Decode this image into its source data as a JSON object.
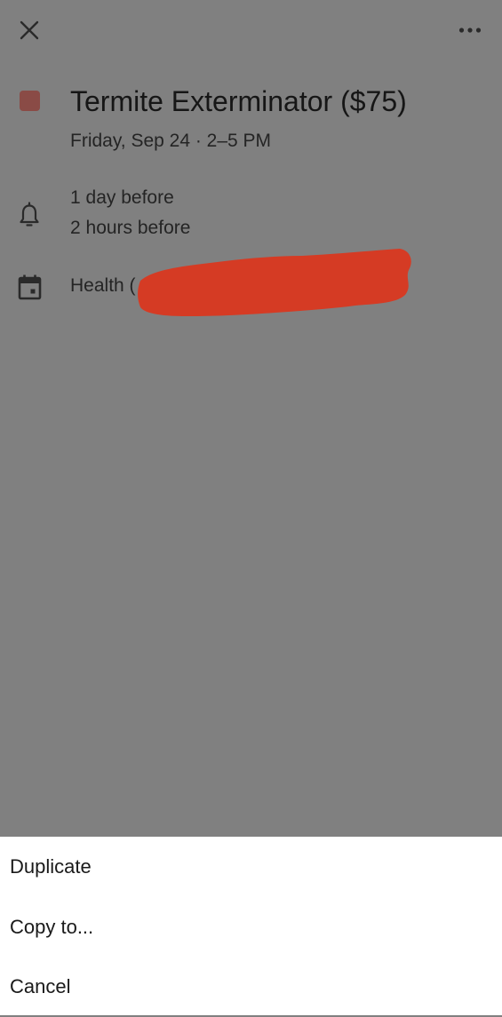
{
  "event": {
    "title": "Termite Exterminator ($75)",
    "datetime": "Friday, Sep 24 · 2–5 PM",
    "color": "#8a4b46",
    "reminders": [
      "1 day before",
      "2 hours before"
    ],
    "calendar_label": "Health ("
  },
  "icons": {
    "close": "close-icon",
    "more": "more-horizontal-icon",
    "reminder": "bell-icon",
    "calendar": "calendar-icon"
  },
  "redaction": {
    "color": "#d53b24"
  },
  "sheet": {
    "items": [
      {
        "label": "Duplicate"
      },
      {
        "label": "Copy to..."
      },
      {
        "label": "Cancel"
      }
    ]
  }
}
